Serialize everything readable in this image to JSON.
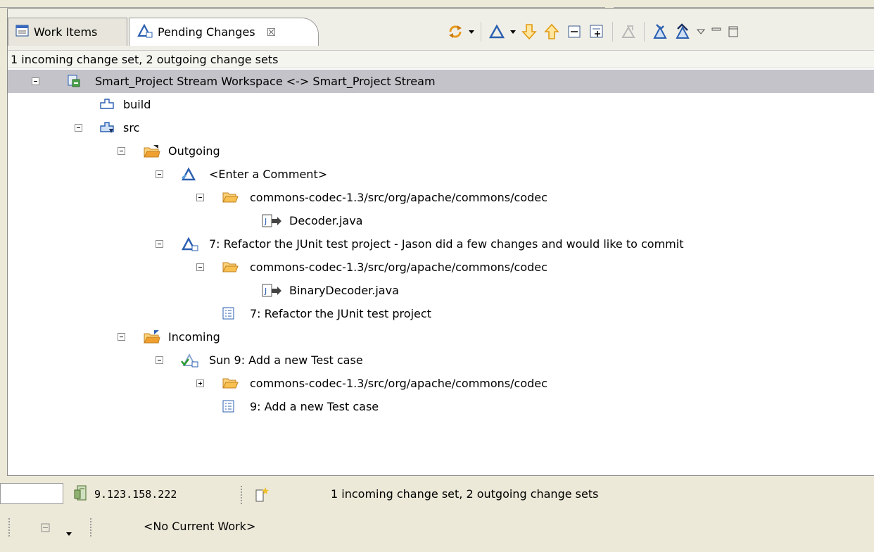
{
  "tabs": [
    {
      "label": "Work Items",
      "icon": "work-items-icon"
    },
    {
      "label": "Pending Changes",
      "icon": "pending-changes-icon",
      "close": "☒"
    }
  ],
  "summary": "1 incoming change set, 2 outgoing change sets",
  "tree": {
    "workspace": "Smart_Project Stream Workspace <-> Smart_Project Stream",
    "build": "build",
    "src": "src",
    "outgoing": "Outgoing",
    "comment": "<Enter a Comment>",
    "folder1": "commons-codec-1.3/src/org/apache/commons/codec",
    "file1": "Decoder.java",
    "changeset7": "7: Refactor the JUnit test project - Jason did a few changes and would like to commit",
    "folder2": "commons-codec-1.3/src/org/apache/commons/codec",
    "file2": "BinaryDecoder.java",
    "workitem7": "7: Refactor the JUnit test project",
    "incoming": "Incoming",
    "changeset9": "Sun  9: Add  a new Test case",
    "folder3": "commons-codec-1.3/src/org/apache/commons/codec",
    "workitem9": "9: Add  a new Test case"
  },
  "statusbar": {
    "ip": "9.123.158.222",
    "message": "1 incoming change set, 2 outgoing change sets",
    "current_work": "<No Current Work>"
  },
  "colors": {
    "selection": "#c3c3c9",
    "accent_blue": "#2a5fb0",
    "folder_orange": "#f0a030"
  }
}
